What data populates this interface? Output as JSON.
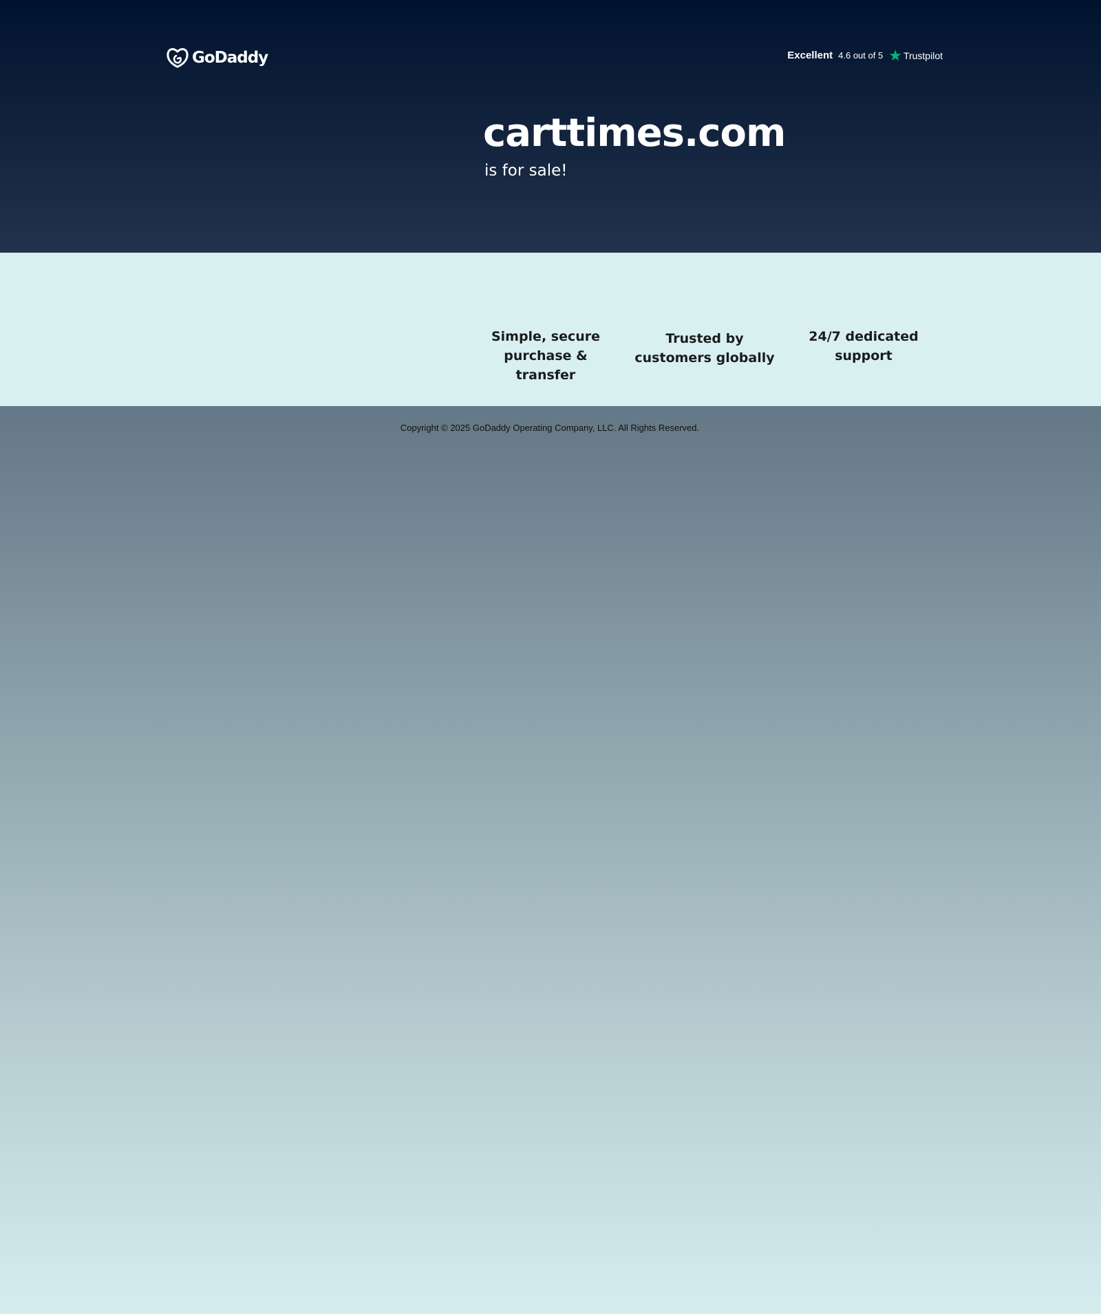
{
  "header": {
    "logo_text": "GoDaddy",
    "trustpilot": {
      "rating_label": "Excellent",
      "score_text": "4.6 out of 5",
      "brand": "Trustpilot",
      "star_color": "#00b67a"
    }
  },
  "hero": {
    "domain": "carttimes.com",
    "subtitle": "is for sale!"
  },
  "features": [
    {
      "label": "Simple, secure purchase & transfer"
    },
    {
      "label": "Trusted by customers globally"
    },
    {
      "label": "24/7 dedicated support"
    }
  ],
  "footer": {
    "copyright": "Copyright © 2025 GoDaddy Operating Company, LLC. All Rights Reserved."
  }
}
